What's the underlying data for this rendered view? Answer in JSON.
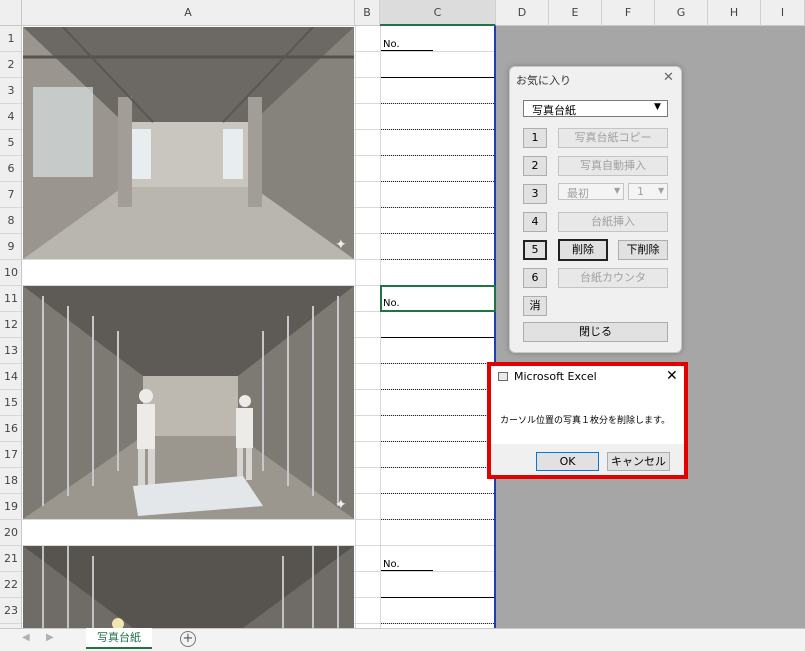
{
  "columns": [
    "A",
    "B",
    "C",
    "D",
    "E",
    "F",
    "G",
    "H",
    "I"
  ],
  "rows": [
    "1",
    "2",
    "3",
    "4",
    "5",
    "6",
    "7",
    "8",
    "9",
    "10",
    "11",
    "12",
    "13",
    "14",
    "15",
    "16",
    "17",
    "18",
    "19",
    "20",
    "21",
    "22",
    "23"
  ],
  "no_label": "No.",
  "sheet_tab": "写真台紙",
  "favorites": {
    "title": "お気に入り",
    "dropdown_value": "写真台紙",
    "numbers": [
      "1",
      "2",
      "3",
      "4",
      "5",
      "6"
    ],
    "clear_label": "消",
    "copy_label": "写真台紙コピー",
    "auto_insert_label": "写真自動挿入",
    "first_option": "最初",
    "count_option": "1",
    "insert_sheet_label": "台紙挿入",
    "delete_label": "削除",
    "delete_below_label": "下削除",
    "counter_label": "台紙カウンタ",
    "close_label": "閉じる"
  },
  "messagebox": {
    "title": "Microsoft Excel",
    "message": "カーソル位置の写真１枚分を削除します。",
    "ok_label": "OK",
    "cancel_label": "キャンセル",
    "highlight_color": "#e30000"
  },
  "colors": {
    "excel_green": "#217346",
    "print_border": "#1c3fb0",
    "background": "#a6a6a6"
  }
}
